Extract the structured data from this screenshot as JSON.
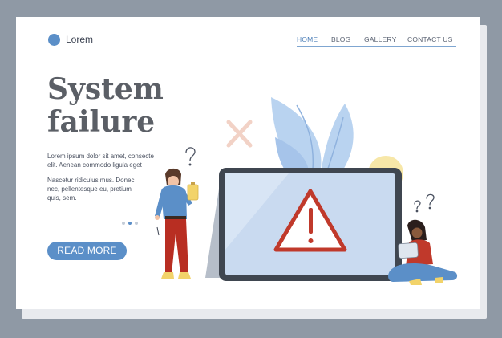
{
  "header": {
    "logo_text": "Lorem",
    "nav": [
      {
        "label": "HOME",
        "active": true
      },
      {
        "label": "BLOG",
        "active": false
      },
      {
        "label": "GALLERY",
        "active": false
      },
      {
        "label": "CONTACT US",
        "active": false
      }
    ]
  },
  "hero": {
    "title_line1": "System",
    "title_line2": "failure",
    "paragraph1_line1": "Lorem ipsum dolor sit amet, consecte",
    "paragraph1_line2": "elit. Aenean commodo ligula eget",
    "paragraph2_line1": "Nascetur ridiculus mus. Donec",
    "paragraph2_line2": "nec, pellentesque eu, pretium",
    "paragraph2_line3": "quis, sem.",
    "button_label": "READ MORE",
    "carousel_active_index": 1
  },
  "illustration": {
    "question_mark": "?",
    "exclamation": "!"
  },
  "colors": {
    "accent_blue": "#5b8fc8",
    "warning_red": "#c0392b",
    "title_gray": "#5b5f66",
    "screen_blue": "#c9daf0"
  }
}
